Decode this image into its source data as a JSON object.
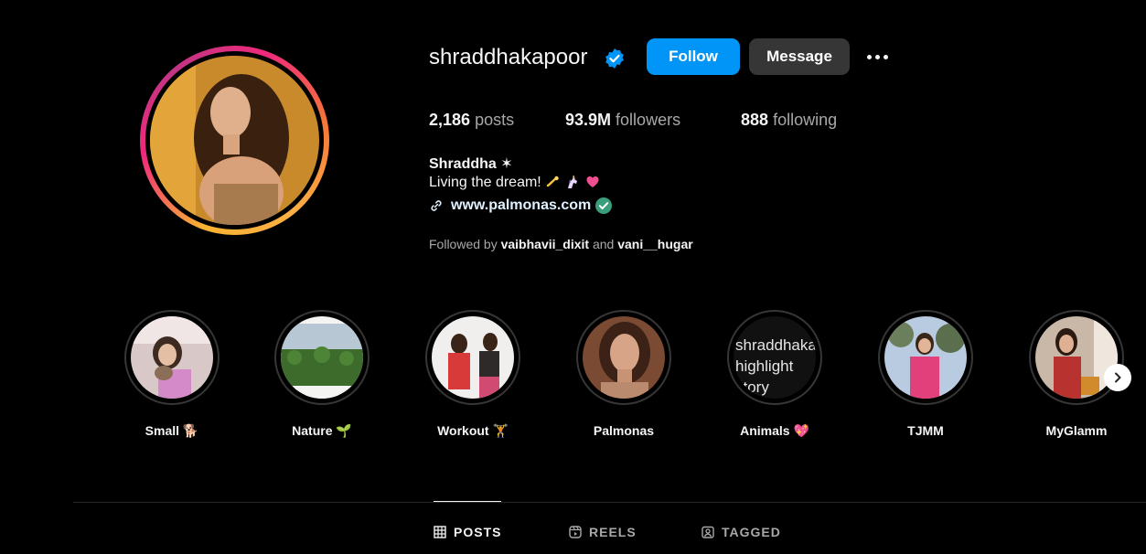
{
  "profile": {
    "username": "shraddhakapoor",
    "full_name": "Shraddha ✶",
    "bio": "Living the dream!",
    "website": "www.palmonas.com",
    "followed_by_prefix": "Followed by",
    "followed_by_user1": "vaibhavii_dixit",
    "followed_by_and": "and",
    "followed_by_user2": "vani__hugar"
  },
  "actions": {
    "follow_label": "Follow",
    "message_label": "Message"
  },
  "stats": {
    "posts_count": "2,186",
    "posts_label": "posts",
    "followers_count": "93.9M",
    "followers_label": "followers",
    "following_count": "888",
    "following_label": "following"
  },
  "highlights": [
    {
      "label": "Small 🐕"
    },
    {
      "label": "Nature 🌱"
    },
    {
      "label": "Workout 🏋"
    },
    {
      "label": "Palmonas"
    },
    {
      "label": "Animals 💖",
      "cover_text": "shraddhakapoor highlight story picture"
    },
    {
      "label": "TJMM"
    },
    {
      "label": "MyGlamm"
    }
  ],
  "tabs": [
    {
      "label": "POSTS",
      "active": true
    },
    {
      "label": "REELS",
      "active": false
    },
    {
      "label": "TAGGED",
      "active": false
    }
  ],
  "colors": {
    "background": "#000000",
    "primary_button": "#0095f6",
    "secondary_button": "#363636",
    "verified_badge": "#0095f6",
    "muted_text": "#a8a8a8"
  },
  "icons": [
    "verified-badge-icon",
    "more-options-icon",
    "link-icon",
    "link-verified-icon",
    "chevron-right-icon",
    "grid-icon",
    "reels-icon",
    "tagged-icon"
  ]
}
